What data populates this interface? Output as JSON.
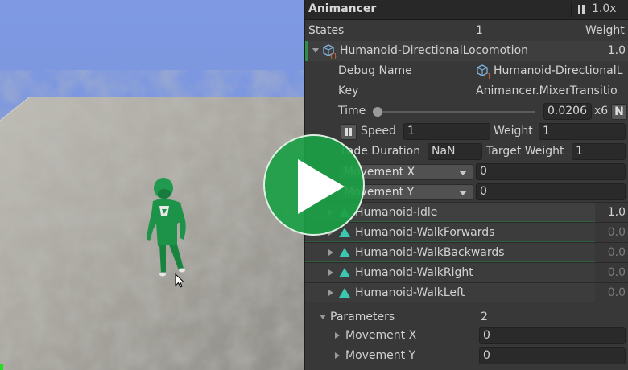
{
  "window": {
    "title": "Animancer",
    "speed": "1.0x"
  },
  "states_header": {
    "label": "States",
    "count": "1",
    "weight_label": "Weight"
  },
  "mixer": {
    "name": "Humanoid-DirectionalLocomotion",
    "weight": "1.0",
    "debug_name_label": "Debug Name",
    "debug_name_value": "Humanoid-DirectionalL",
    "key_label": "Key",
    "key_value": "Animancer.MixerTransitio",
    "time_label": "Time",
    "time_value": "0.0206",
    "time_loops": "x6",
    "normalize_button": "N",
    "speed_label": "Speed",
    "speed_value": "1",
    "weight_label": "Weight",
    "weight_value": "1",
    "fade_label": "Fade Duration",
    "fade_value": "NaN",
    "target_weight_label": "Target Weight",
    "target_weight_value": "1",
    "param_x_label": "Movement X",
    "param_x_value": "0",
    "param_y_label": "Movement Y",
    "param_y_value": "0"
  },
  "children": [
    {
      "name": "Humanoid-Idle",
      "weight": "1.0"
    },
    {
      "name": "Humanoid-WalkForwards",
      "weight": "0.0"
    },
    {
      "name": "Humanoid-WalkBackwards",
      "weight": "0.0"
    },
    {
      "name": "Humanoid-WalkRight",
      "weight": "0.0"
    },
    {
      "name": "Humanoid-WalkLeft",
      "weight": "0.0"
    }
  ],
  "parameters": {
    "label": "Parameters",
    "count": "2",
    "items": [
      {
        "name": "Movement X",
        "value": "0"
      },
      {
        "name": "Movement Y",
        "value": "0"
      }
    ]
  },
  "colors": {
    "accent_green": "#2f8f4a",
    "clip_icon": "#3cc7b1",
    "play_overlay": "#1ca046",
    "character": "#1f9a4e"
  },
  "icons": [
    "pause-icon",
    "mixer-state-icon",
    "clip-icon",
    "play-icon",
    "cursor-icon",
    "expand-arrow-icon"
  ]
}
